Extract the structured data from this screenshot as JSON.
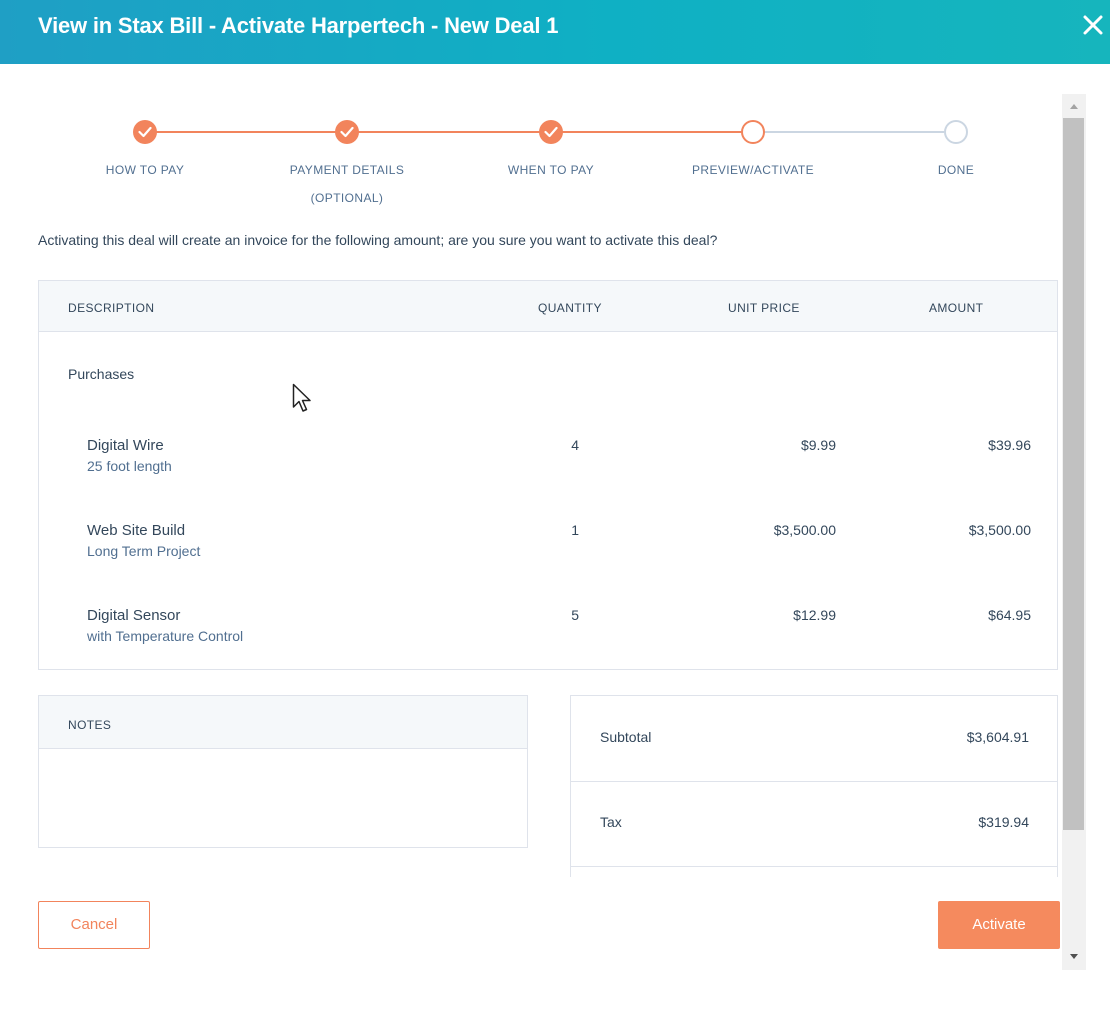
{
  "header": {
    "title": "View in Stax Bill - Activate Harpertech - New Deal 1"
  },
  "stepper": {
    "steps": [
      {
        "label": "HOW TO PAY",
        "sub": "",
        "state": "done"
      },
      {
        "label": "PAYMENT DETAILS",
        "sub": "(OPTIONAL)",
        "state": "done"
      },
      {
        "label": "WHEN TO PAY",
        "sub": "",
        "state": "done"
      },
      {
        "label": "PREVIEW/ACTIVATE",
        "sub": "",
        "state": "current"
      },
      {
        "label": "DONE",
        "sub": "",
        "state": "todo"
      }
    ]
  },
  "intro_text": "Activating this deal will create an invoice for the following amount; are you sure you want to activate this deal?",
  "table": {
    "headers": {
      "description": "DESCRIPTION",
      "quantity": "QUANTITY",
      "unit_price": "UNIT PRICE",
      "amount": "AMOUNT"
    },
    "group_label": "Purchases",
    "items": [
      {
        "name": "Digital Wire",
        "desc": "25 foot length",
        "qty": "4",
        "unit_price": "$9.99",
        "amount": "$39.96"
      },
      {
        "name": "Web Site Build",
        "desc": "Long Term Project",
        "qty": "1",
        "unit_price": "$3,500.00",
        "amount": "$3,500.00"
      },
      {
        "name": "Digital Sensor",
        "desc": "with Temperature Control",
        "qty": "5",
        "unit_price": "$12.99",
        "amount": "$64.95"
      }
    ]
  },
  "notes": {
    "label": "NOTES",
    "value": ""
  },
  "totals": {
    "subtotal_label": "Subtotal",
    "subtotal_value": "$3,604.91",
    "tax_label": "Tax",
    "tax_value": "$319.94"
  },
  "buttons": {
    "cancel": "Cancel",
    "activate": "Activate"
  },
  "colors": {
    "accent": "#f2845c",
    "header_start": "#1f9fc5",
    "header_end": "#16b5bd",
    "pending": "#cbd6e2"
  }
}
